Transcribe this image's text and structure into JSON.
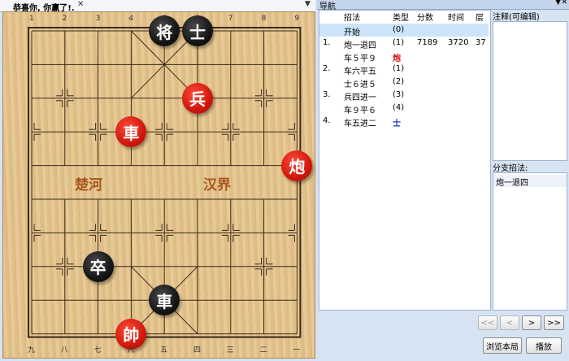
{
  "board_tab": {
    "title": "恭喜你, 你赢了!.",
    "close": "✕",
    "arrow": "▼"
  },
  "board": {
    "top_coords": [
      "1",
      "2",
      "3",
      "4",
      "5",
      "6",
      "7",
      "8",
      "9"
    ],
    "bottom_coords": [
      "九",
      "八",
      "七",
      "六",
      "五",
      "四",
      "三",
      "二",
      "一"
    ],
    "river_left": "楚河",
    "river_right": "汉界",
    "pieces": [
      {
        "char": "将",
        "color": "black",
        "col": 4,
        "row": 0
      },
      {
        "char": "士",
        "color": "black",
        "col": 5,
        "row": 0
      },
      {
        "char": "兵",
        "color": "red",
        "col": 5,
        "row": 2
      },
      {
        "char": "車",
        "color": "red",
        "col": 3,
        "row": 3
      },
      {
        "char": "炮",
        "color": "red",
        "col": 8,
        "row": 4
      },
      {
        "char": "卒",
        "color": "black",
        "col": 2,
        "row": 7
      },
      {
        "char": "車",
        "color": "black",
        "col": 4,
        "row": 8
      },
      {
        "char": "帥",
        "color": "red",
        "col": 3,
        "row": 9
      }
    ]
  },
  "nav": {
    "title": "导航",
    "pin": "▼",
    "close": "✕",
    "headers": {
      "move": "招法",
      "type": "类型",
      "score": "分数",
      "time": "时间",
      "depth": "层"
    },
    "rows": [
      {
        "num": "",
        "move": "开始",
        "type": "(0)",
        "score": "",
        "time": "",
        "depth": "",
        "selected": true,
        "type_color": "#000000"
      },
      {
        "num": "1.",
        "move": "炮一退四",
        "type": "(1)",
        "score": "7189",
        "time": "3720",
        "depth": "37",
        "selected": false,
        "type_color": "#000000"
      },
      {
        "num": "",
        "move": "车５平９",
        "type": "炮",
        "score": "",
        "time": "",
        "depth": "",
        "selected": false,
        "type_color": "#d01010"
      },
      {
        "num": "2.",
        "move": "车六平五",
        "type": "(1)",
        "score": "",
        "time": "",
        "depth": "",
        "selected": false,
        "type_color": "#000000"
      },
      {
        "num": "",
        "move": "士６进５",
        "type": "(2)",
        "score": "",
        "time": "",
        "depth": "",
        "selected": false,
        "type_color": "#000000"
      },
      {
        "num": "3.",
        "move": "兵四进一",
        "type": "(3)",
        "score": "",
        "time": "",
        "depth": "",
        "selected": false,
        "type_color": "#000000"
      },
      {
        "num": "",
        "move": "车９平６",
        "type": "(4)",
        "score": "",
        "time": "",
        "depth": "",
        "selected": false,
        "type_color": "#000000"
      },
      {
        "num": "4.",
        "move": "车五进二",
        "type": "士",
        "score": "",
        "time": "",
        "depth": "",
        "selected": false,
        "type_color": "#1a3fb0"
      }
    ]
  },
  "notes": {
    "label": "注释(可编辑)"
  },
  "branch": {
    "label": "分支招法:",
    "items": [
      "炮一退四"
    ]
  },
  "controls": {
    "first": "<<",
    "prev": "<",
    "next": ">",
    "last": ">>",
    "browse": "浏览本局",
    "play": "播放"
  }
}
